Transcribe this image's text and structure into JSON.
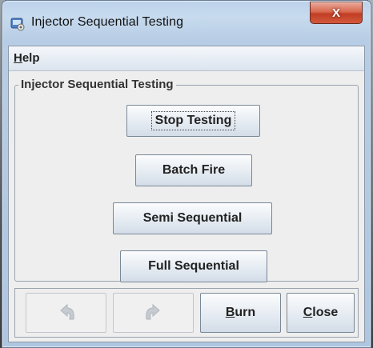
{
  "window": {
    "title": "Injector Sequential Testing",
    "close_label": "X",
    "accent": "#c13e24"
  },
  "menu": {
    "help_mnemonic": "H",
    "help_rest": "elp"
  },
  "group": {
    "title": "Injector Sequential Testing",
    "buttons": [
      {
        "label": "Stop Testing"
      },
      {
        "label": "Batch Fire"
      },
      {
        "label": "Semi Sequential"
      },
      {
        "label": "Full Sequential"
      }
    ]
  },
  "bottom": {
    "undo_icon": "undo-icon",
    "redo_icon": "redo-icon",
    "burn_mnemonic": "B",
    "burn_rest": "urn",
    "close_mnemonic": "C",
    "close_rest": "lose"
  }
}
